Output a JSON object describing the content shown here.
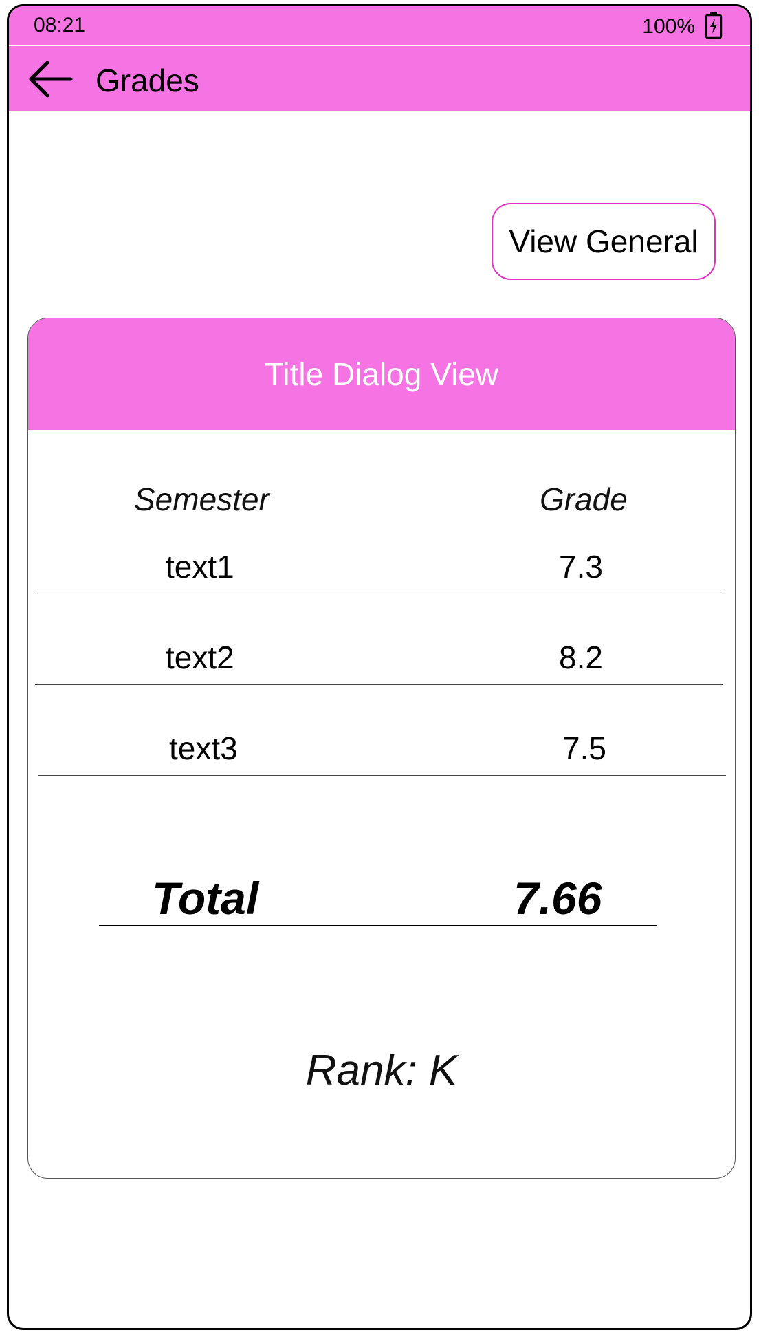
{
  "status_bar": {
    "time": "08:21",
    "battery": "100%",
    "battery_icon": "battery-charging-icon"
  },
  "app_bar": {
    "title": "Grades",
    "back_icon": "arrow-left-icon"
  },
  "actions": {
    "view_general_label": "View General"
  },
  "dialog": {
    "title": "Title Dialog View",
    "columns": {
      "semester": "Semester",
      "grade": "Grade"
    },
    "rows": [
      {
        "semester": "text1",
        "grade": "7.3"
      },
      {
        "semester": "text2",
        "grade": "8.2"
      },
      {
        "semester": "text3",
        "grade": "7.5"
      }
    ],
    "total": {
      "label": "Total",
      "value": "7.66"
    },
    "rank": "Rank: K"
  },
  "colors": {
    "accent": "#f573e2",
    "button_border": "#e52dc8"
  }
}
